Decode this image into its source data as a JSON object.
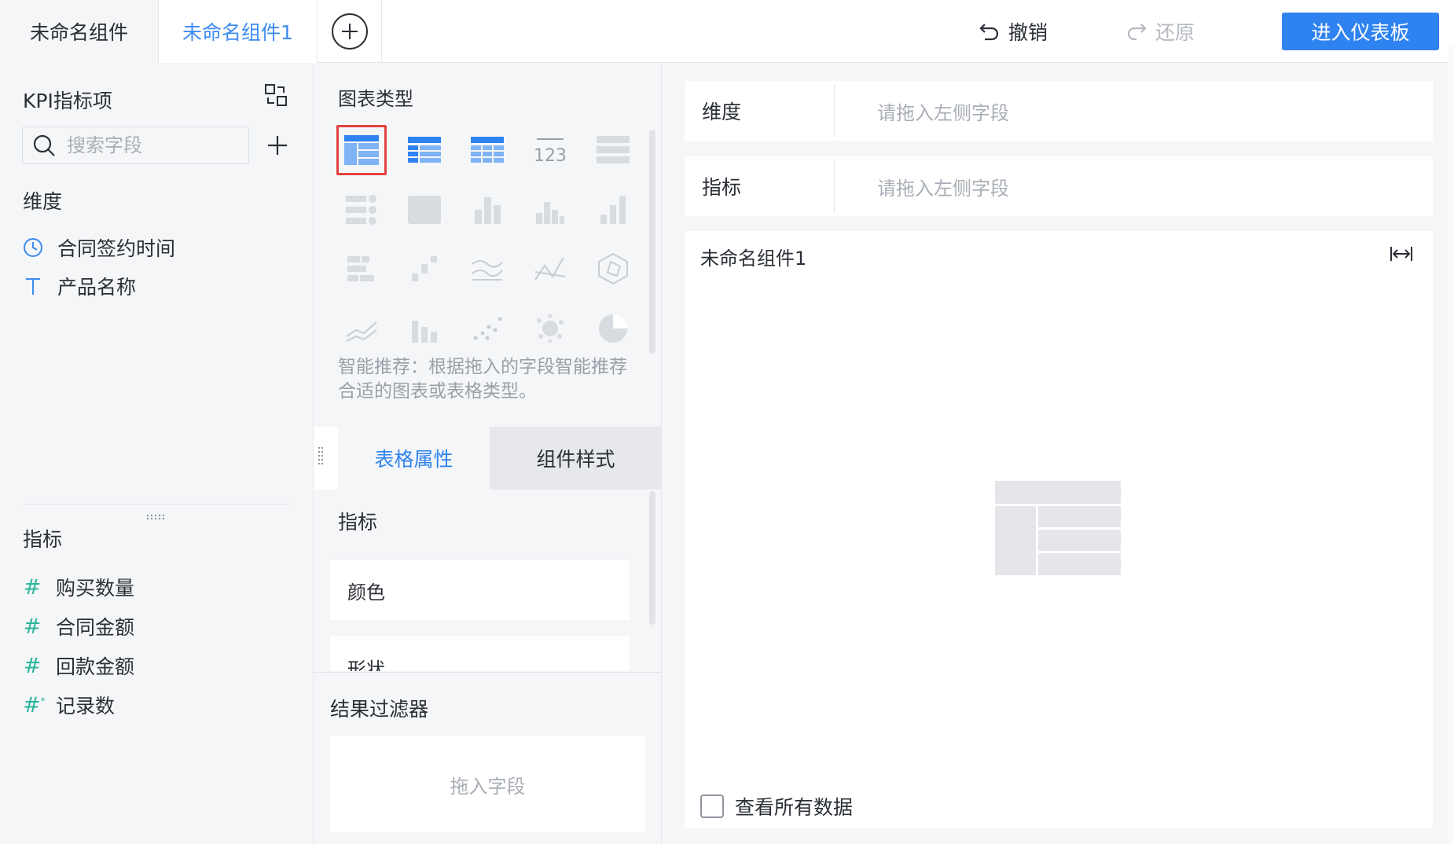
{
  "tabs": [
    {
      "label": "未命名组件",
      "active": false
    },
    {
      "label": "未命名组件1",
      "active": true
    }
  ],
  "toolbar": {
    "undo_label": "撤销",
    "redo_label": "还原",
    "enter_dashboard_label": "进入仪表板"
  },
  "left_panel": {
    "title": "KPI指标项",
    "search_placeholder": "搜索字段",
    "dimension_header": "维度",
    "dimension_fields": [
      {
        "label": "合同签约时间",
        "icon": "clock-icon"
      },
      {
        "label": "产品名称",
        "icon": "text-type-icon"
      }
    ],
    "measure_header": "指标",
    "measure_fields": [
      {
        "label": "购买数量",
        "icon": "hash-icon"
      },
      {
        "label": "合同金额",
        "icon": "hash-icon"
      },
      {
        "label": "回款金额",
        "icon": "hash-icon"
      },
      {
        "label": "记录数",
        "icon": "hash-star-icon"
      }
    ]
  },
  "middle_panel": {
    "chart_type_header": "图表类型",
    "chart_type_icons": [
      "table-icon",
      "cross-table-icon",
      "detail-table-icon",
      "kpi-number-icon",
      "kpi-list-icon",
      "kpi-grid-icon",
      "map-icon",
      "stacked-bar-icon",
      "grouped-bar-icon",
      "column-bar-icon",
      "bar-horizontal-icon",
      "waterfall-icon",
      "stream-line-icon",
      "polyline-icon",
      "radar-icon",
      "area-line-icon",
      "range-bar-icon",
      "scatter-icon",
      "bubble-icon",
      "pie-icon"
    ],
    "selected_chart_type": "table-icon",
    "smart_tip": "智能推荐：根据拖入的字段智能推荐合适的图表或表格类型。",
    "tabs": {
      "table_attr": "表格属性",
      "widget_style": "组件样式"
    },
    "attr_section_label": "指标",
    "attr_cards": [
      "颜色",
      "形状"
    ],
    "filter_header": "结果过滤器",
    "filter_drop_placeholder": "拖入字段"
  },
  "right_panel": {
    "dimension_label": "维度",
    "dimension_placeholder": "请拖入左侧字段",
    "measure_label": "指标",
    "measure_placeholder": "请拖入左侧字段",
    "widget_title": "未命名组件1",
    "view_all_label": "查看所有数据",
    "view_all_checked": false
  },
  "colors": {
    "accent": "#2f83f0",
    "selected_border": "#e3413f",
    "measure_hash": "#2bb59b"
  }
}
